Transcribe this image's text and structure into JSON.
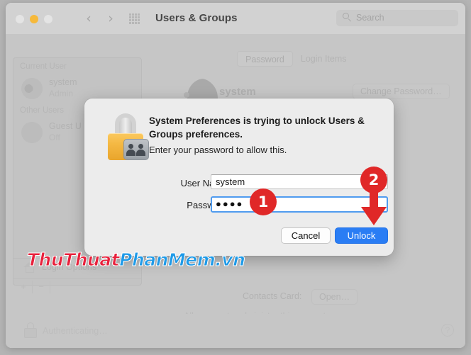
{
  "window": {
    "title": "Users & Groups",
    "traffic_lights": [
      "close",
      "minimize",
      "maximize"
    ],
    "nav_back": "‹",
    "nav_forward": "›",
    "grid_icon": "grid-icon",
    "search": {
      "placeholder": "Search",
      "value": ""
    }
  },
  "sidebar": {
    "groups": [
      {
        "header": "Current User",
        "items": [
          {
            "name": "system",
            "sub": "Admin"
          }
        ]
      },
      {
        "header": "Other Users",
        "items": [
          {
            "name": "Guest U",
            "sub": "Off"
          }
        ]
      }
    ],
    "login_options": "Login Options",
    "add_button": "+",
    "remove_button": "−"
  },
  "main": {
    "tabs": [
      {
        "label": "Password",
        "selected": true
      },
      {
        "label": "Login Items",
        "selected": false
      }
    ],
    "account_name": "system",
    "change_password_button": "Change Password…",
    "contacts_card_label": "Contacts Card:",
    "open_contacts_button": "Open…",
    "admin_checkbox_mark": "✓",
    "admin_checkbox_label": "Allow user to administer this computer"
  },
  "bottom_bar": {
    "status": "Authenticating…",
    "lock_icon": "lock-icon",
    "help_button": "?"
  },
  "dialog": {
    "icon": "lock-with-users-badge-icon",
    "title": "System Preferences is trying to unlock Users & Groups preferences.",
    "subtitle": "Enter your password to allow this.",
    "fields": [
      {
        "label": "User Name:",
        "value": "system"
      },
      {
        "label": "Password:",
        "value": "●●●●"
      }
    ],
    "username_label": "User Name:",
    "username_value": "system",
    "password_label": "Password:",
    "password_value": "●●●●",
    "cancel_button": "Cancel",
    "unlock_button": "Unlock"
  },
  "annotations": {
    "step1": "1",
    "step2": "2",
    "arrow": "down-arrow-icon"
  },
  "watermark": {
    "part1": "ThuThuat",
    "part2": "PhanMem.vn"
  },
  "colors": {
    "accent_blue": "#2a7df4",
    "annotation_red": "#e02828",
    "lock_gold": "#f4b843",
    "watermark_red": "#e8213c",
    "watermark_blue": "#1e9ae8"
  }
}
